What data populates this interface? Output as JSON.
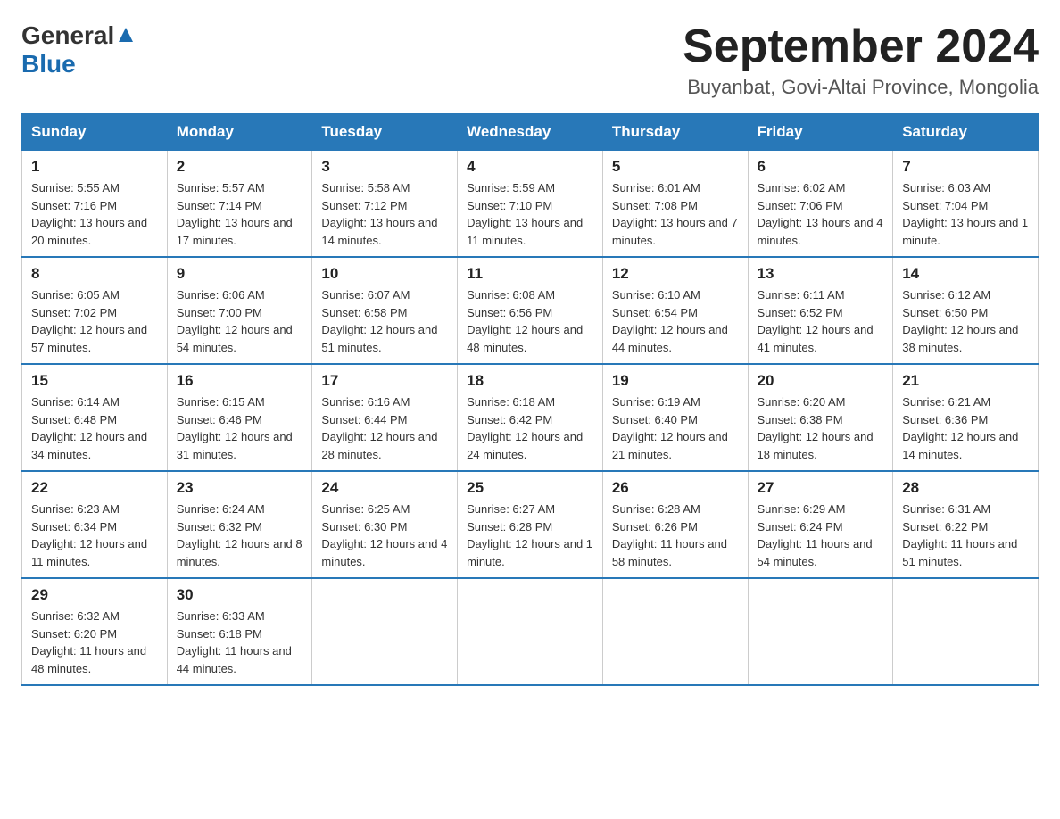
{
  "header": {
    "logo_general": "General",
    "logo_blue": "Blue",
    "title": "September 2024",
    "subtitle": "Buyanbat, Govi-Altai Province, Mongolia"
  },
  "weekdays": [
    "Sunday",
    "Monday",
    "Tuesday",
    "Wednesday",
    "Thursday",
    "Friday",
    "Saturday"
  ],
  "weeks": [
    [
      {
        "day": "1",
        "sunrise": "Sunrise: 5:55 AM",
        "sunset": "Sunset: 7:16 PM",
        "daylight": "Daylight: 13 hours and 20 minutes."
      },
      {
        "day": "2",
        "sunrise": "Sunrise: 5:57 AM",
        "sunset": "Sunset: 7:14 PM",
        "daylight": "Daylight: 13 hours and 17 minutes."
      },
      {
        "day": "3",
        "sunrise": "Sunrise: 5:58 AM",
        "sunset": "Sunset: 7:12 PM",
        "daylight": "Daylight: 13 hours and 14 minutes."
      },
      {
        "day": "4",
        "sunrise": "Sunrise: 5:59 AM",
        "sunset": "Sunset: 7:10 PM",
        "daylight": "Daylight: 13 hours and 11 minutes."
      },
      {
        "day": "5",
        "sunrise": "Sunrise: 6:01 AM",
        "sunset": "Sunset: 7:08 PM",
        "daylight": "Daylight: 13 hours and 7 minutes."
      },
      {
        "day": "6",
        "sunrise": "Sunrise: 6:02 AM",
        "sunset": "Sunset: 7:06 PM",
        "daylight": "Daylight: 13 hours and 4 minutes."
      },
      {
        "day": "7",
        "sunrise": "Sunrise: 6:03 AM",
        "sunset": "Sunset: 7:04 PM",
        "daylight": "Daylight: 13 hours and 1 minute."
      }
    ],
    [
      {
        "day": "8",
        "sunrise": "Sunrise: 6:05 AM",
        "sunset": "Sunset: 7:02 PM",
        "daylight": "Daylight: 12 hours and 57 minutes."
      },
      {
        "day": "9",
        "sunrise": "Sunrise: 6:06 AM",
        "sunset": "Sunset: 7:00 PM",
        "daylight": "Daylight: 12 hours and 54 minutes."
      },
      {
        "day": "10",
        "sunrise": "Sunrise: 6:07 AM",
        "sunset": "Sunset: 6:58 PM",
        "daylight": "Daylight: 12 hours and 51 minutes."
      },
      {
        "day": "11",
        "sunrise": "Sunrise: 6:08 AM",
        "sunset": "Sunset: 6:56 PM",
        "daylight": "Daylight: 12 hours and 48 minutes."
      },
      {
        "day": "12",
        "sunrise": "Sunrise: 6:10 AM",
        "sunset": "Sunset: 6:54 PM",
        "daylight": "Daylight: 12 hours and 44 minutes."
      },
      {
        "day": "13",
        "sunrise": "Sunrise: 6:11 AM",
        "sunset": "Sunset: 6:52 PM",
        "daylight": "Daylight: 12 hours and 41 minutes."
      },
      {
        "day": "14",
        "sunrise": "Sunrise: 6:12 AM",
        "sunset": "Sunset: 6:50 PM",
        "daylight": "Daylight: 12 hours and 38 minutes."
      }
    ],
    [
      {
        "day": "15",
        "sunrise": "Sunrise: 6:14 AM",
        "sunset": "Sunset: 6:48 PM",
        "daylight": "Daylight: 12 hours and 34 minutes."
      },
      {
        "day": "16",
        "sunrise": "Sunrise: 6:15 AM",
        "sunset": "Sunset: 6:46 PM",
        "daylight": "Daylight: 12 hours and 31 minutes."
      },
      {
        "day": "17",
        "sunrise": "Sunrise: 6:16 AM",
        "sunset": "Sunset: 6:44 PM",
        "daylight": "Daylight: 12 hours and 28 minutes."
      },
      {
        "day": "18",
        "sunrise": "Sunrise: 6:18 AM",
        "sunset": "Sunset: 6:42 PM",
        "daylight": "Daylight: 12 hours and 24 minutes."
      },
      {
        "day": "19",
        "sunrise": "Sunrise: 6:19 AM",
        "sunset": "Sunset: 6:40 PM",
        "daylight": "Daylight: 12 hours and 21 minutes."
      },
      {
        "day": "20",
        "sunrise": "Sunrise: 6:20 AM",
        "sunset": "Sunset: 6:38 PM",
        "daylight": "Daylight: 12 hours and 18 minutes."
      },
      {
        "day": "21",
        "sunrise": "Sunrise: 6:21 AM",
        "sunset": "Sunset: 6:36 PM",
        "daylight": "Daylight: 12 hours and 14 minutes."
      }
    ],
    [
      {
        "day": "22",
        "sunrise": "Sunrise: 6:23 AM",
        "sunset": "Sunset: 6:34 PM",
        "daylight": "Daylight: 12 hours and 11 minutes."
      },
      {
        "day": "23",
        "sunrise": "Sunrise: 6:24 AM",
        "sunset": "Sunset: 6:32 PM",
        "daylight": "Daylight: 12 hours and 8 minutes."
      },
      {
        "day": "24",
        "sunrise": "Sunrise: 6:25 AM",
        "sunset": "Sunset: 6:30 PM",
        "daylight": "Daylight: 12 hours and 4 minutes."
      },
      {
        "day": "25",
        "sunrise": "Sunrise: 6:27 AM",
        "sunset": "Sunset: 6:28 PM",
        "daylight": "Daylight: 12 hours and 1 minute."
      },
      {
        "day": "26",
        "sunrise": "Sunrise: 6:28 AM",
        "sunset": "Sunset: 6:26 PM",
        "daylight": "Daylight: 11 hours and 58 minutes."
      },
      {
        "day": "27",
        "sunrise": "Sunrise: 6:29 AM",
        "sunset": "Sunset: 6:24 PM",
        "daylight": "Daylight: 11 hours and 54 minutes."
      },
      {
        "day": "28",
        "sunrise": "Sunrise: 6:31 AM",
        "sunset": "Sunset: 6:22 PM",
        "daylight": "Daylight: 11 hours and 51 minutes."
      }
    ],
    [
      {
        "day": "29",
        "sunrise": "Sunrise: 6:32 AM",
        "sunset": "Sunset: 6:20 PM",
        "daylight": "Daylight: 11 hours and 48 minutes."
      },
      {
        "day": "30",
        "sunrise": "Sunrise: 6:33 AM",
        "sunset": "Sunset: 6:18 PM",
        "daylight": "Daylight: 11 hours and 44 minutes."
      },
      null,
      null,
      null,
      null,
      null
    ]
  ]
}
